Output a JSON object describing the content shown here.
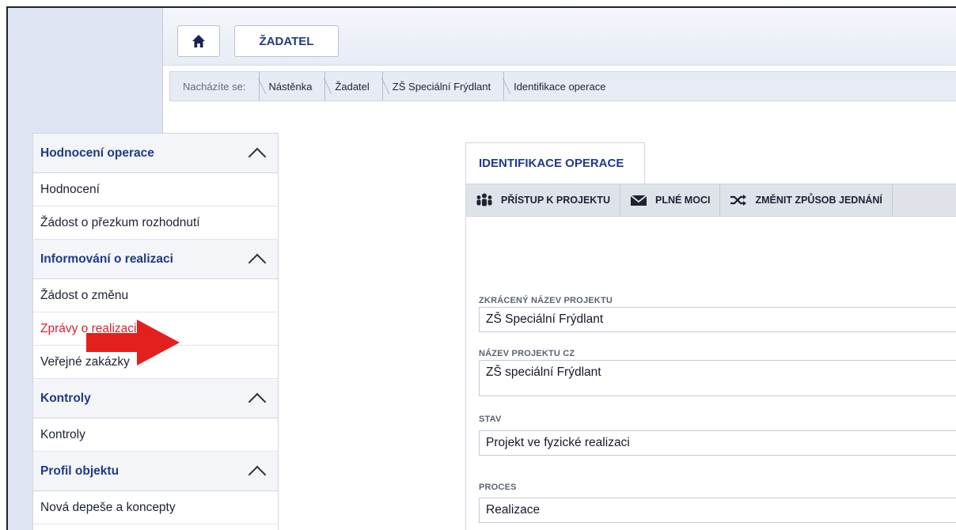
{
  "topbar": {
    "home_icon": "home-icon",
    "applicant_label": "ŽADATEL"
  },
  "breadcrumb": {
    "prefix": "Nacházíte se:",
    "items": [
      "Nástěnka",
      "Žadatel",
      "ZŠ Speciální Frýdlant",
      "Identifikace operace"
    ]
  },
  "sidebar": {
    "sections": [
      {
        "title": "Hodnocení operace",
        "items": [
          "Hodnocení",
          "Žádost o přezkum rozhodnutí"
        ]
      },
      {
        "title": "Informování o realizaci",
        "items": [
          "Žádost o změnu",
          "Zprávy o realizaci",
          "Veřejné zakázky"
        ]
      },
      {
        "title": "Kontroly",
        "items": [
          "Kontroly"
        ]
      },
      {
        "title": "Profil objektu",
        "items": [
          "Nová depeše a koncepty"
        ]
      }
    ],
    "active_item": "Zprávy o realizaci"
  },
  "tab": {
    "label": "IDENTIFIKACE OPERACE"
  },
  "toolbar": {
    "items": [
      {
        "icon": "users-icon",
        "label": "PŘÍSTUP K PROJEKTU"
      },
      {
        "icon": "envelope-icon",
        "label": "PLNÉ MOCI"
      },
      {
        "icon": "shuffle-icon",
        "label": "ZMĚNIT ZPŮSOB JEDNÁNÍ"
      }
    ]
  },
  "form": {
    "short_name_label": "ZKRÁCENÝ NÁZEV PROJEKTU",
    "short_name_value": "ZŠ Speciální Frýdlant",
    "name_cz_label": "NÁZEV PROJEKTU CZ",
    "name_cz_value": "ZŠ speciální Frýdlant",
    "status_label": "STAV",
    "status_value": "Projekt ve fyzické realizaci",
    "process_label": "PROCES",
    "process_value": "Realizace"
  },
  "colors": {
    "brand_blue": "#1f3a88",
    "active_red": "#d8232f",
    "arrow_red": "#e3201d"
  }
}
